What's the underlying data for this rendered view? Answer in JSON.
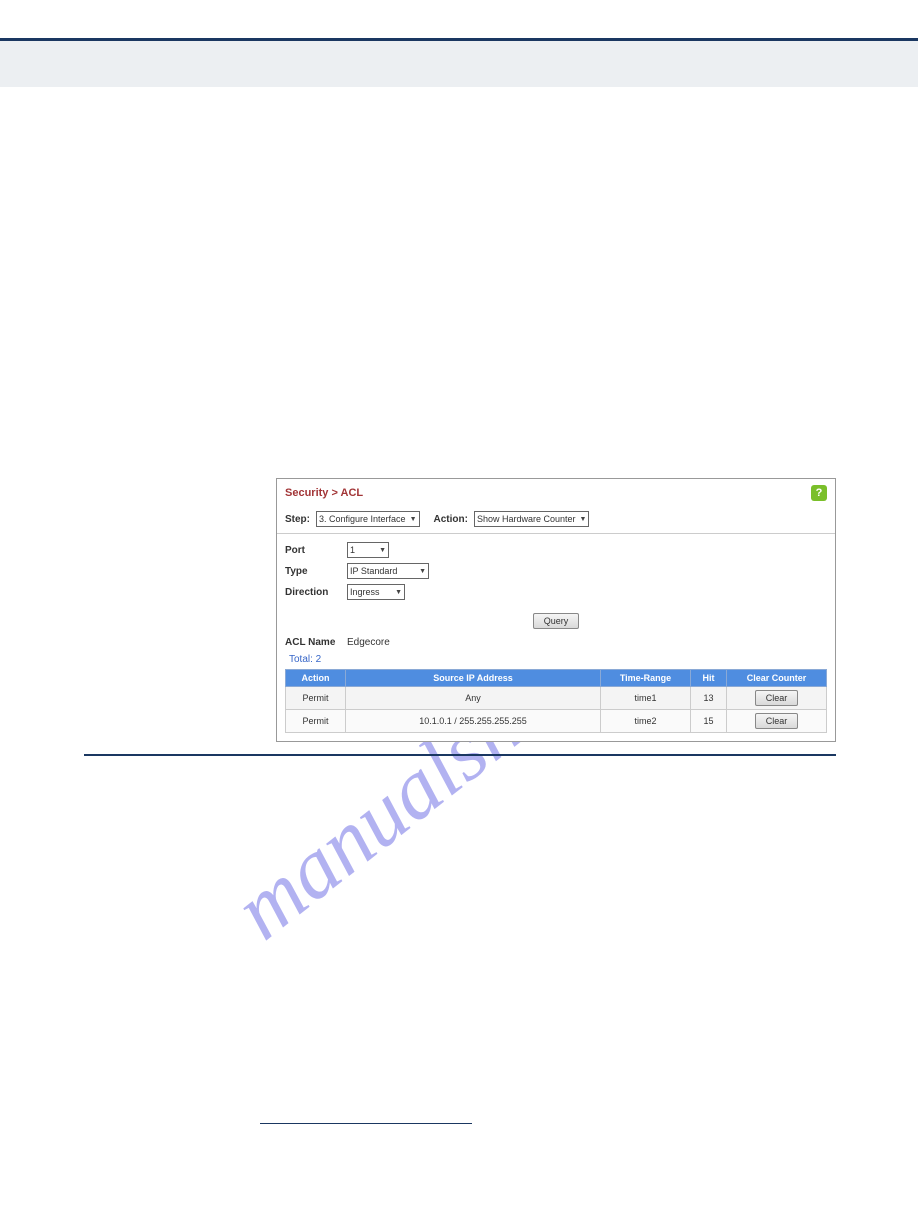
{
  "breadcrumb": "Security > ACL",
  "help_symbol": "?",
  "filter": {
    "step_label": "Step:",
    "step_value": "3. Configure Interface",
    "action_label": "Action:",
    "action_value": "Show Hardware Counter"
  },
  "form": {
    "port_label": "Port",
    "port_value": "1",
    "type_label": "Type",
    "type_value": "IP Standard",
    "direction_label": "Direction",
    "direction_value": "Ingress"
  },
  "query_button": "Query",
  "acl_name_label": "ACL Name",
  "acl_name_value": "Edgecore",
  "total_label": "Total: 2",
  "table": {
    "headers": {
      "action": "Action",
      "source": "Source IP Address",
      "time": "Time-Range",
      "hit": "Hit",
      "clear": "Clear Counter"
    },
    "rows": [
      {
        "action": "Permit",
        "source": "Any",
        "time": "time1",
        "hit": "13",
        "clear": "Clear"
      },
      {
        "action": "Permit",
        "source": "10.1.0.1 / 255.255.255.255",
        "time": "time2",
        "hit": "15",
        "clear": "Clear"
      }
    ]
  },
  "watermark_text": "manualshive.com"
}
